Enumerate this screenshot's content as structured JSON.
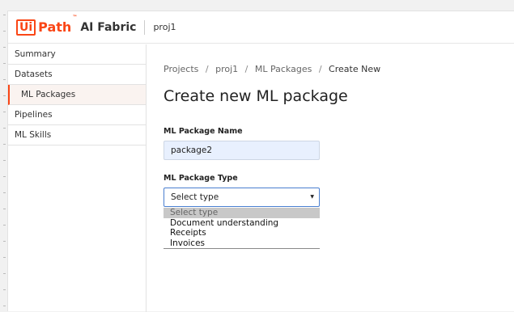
{
  "header": {
    "logo_ui": "Ui",
    "logo_path": "Path",
    "logo_tm": "™",
    "logo_product": "AI Fabric",
    "project": "proj1"
  },
  "sidebar": {
    "items": [
      {
        "label": "Summary"
      },
      {
        "label": "Datasets"
      },
      {
        "label": "ML Packages"
      },
      {
        "label": "Pipelines"
      },
      {
        "label": "ML Skills"
      }
    ]
  },
  "breadcrumb": {
    "items": [
      "Projects",
      "proj1",
      "ML Packages",
      "Create New"
    ],
    "separator": "/"
  },
  "main": {
    "title": "Create new ML package",
    "name_label": "ML Package Name",
    "name_value": "package2",
    "type_label": "ML Package Type",
    "type_selected": "Select type",
    "type_options": [
      "Select type",
      "Document understanding",
      "Receipts",
      "Invoices"
    ]
  },
  "colors": {
    "brand": "#fa4616",
    "input_focus_border": "#4a7fd0",
    "autofill_bg": "#e8f0fe"
  }
}
